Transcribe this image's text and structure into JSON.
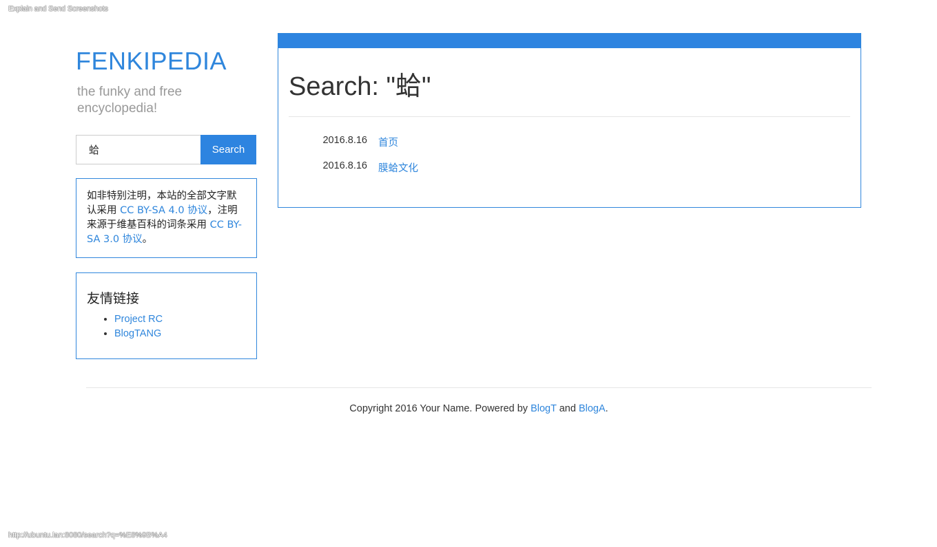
{
  "extension_label": "Explain and Send Screenshots",
  "status_url": "http://ubuntu.lan:8080/search?q=%E8%9B%A4",
  "site": {
    "title": "FENKIPEDIA",
    "tagline": "the funky and free encyclopedia!"
  },
  "search": {
    "value": "蛤",
    "button_label": "Search"
  },
  "license": {
    "text1": "如非特别注明，本站的全部文字默认采用 ",
    "link1": "CC BY-SA 4.0 协议",
    "text2": "，注明来源于维基百科的词条采用 ",
    "link2": "CC BY-SA 3.0 协议",
    "text3": "。"
  },
  "links": {
    "title": "友情链接",
    "items": [
      {
        "label": "Project RC"
      },
      {
        "label": "BlogTANG"
      }
    ]
  },
  "main": {
    "heading": "Search: \"蛤\"",
    "results": [
      {
        "date": "2016.8.16",
        "title": "首页"
      },
      {
        "date": "2016.8.16",
        "title": "膜蛤文化"
      }
    ]
  },
  "footer": {
    "text1": "Copyright 2016 Your Name. Powered by ",
    "link1": "BlogT",
    "text2": " and ",
    "link2": "BlogA",
    "text3": "."
  },
  "colors": {
    "accent": "#2d84e0",
    "link": "#2f86dc",
    "muted": "#999999"
  }
}
